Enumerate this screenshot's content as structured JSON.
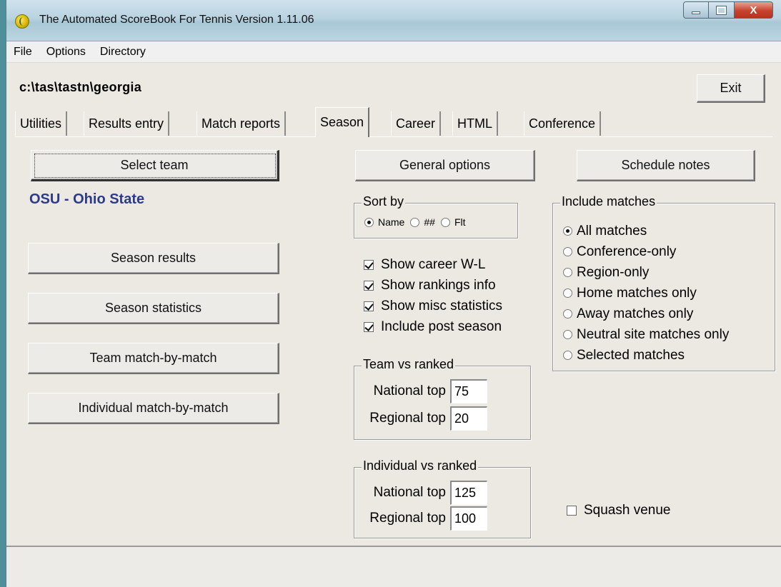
{
  "window": {
    "title": "The Automated ScoreBook For Tennis  Version 1.11.06",
    "controls": {
      "minimize_icon": "minimize-icon",
      "maximize_icon": "maximize-icon",
      "close_glyph": "X"
    }
  },
  "menu": [
    "File",
    "Options",
    "Directory"
  ],
  "path": "c:\\tas\\tastn\\georgia",
  "exit_label": "Exit",
  "tabs": [
    {
      "label": "Utilities",
      "active": false
    },
    {
      "label": "Results entry",
      "active": false
    },
    {
      "label": "Match reports",
      "active": false
    },
    {
      "label": "Season",
      "active": true
    },
    {
      "label": "Career",
      "active": false
    },
    {
      "label": "HTML",
      "active": false
    },
    {
      "label": "Conference",
      "active": false
    }
  ],
  "left": {
    "select_team": "Select team",
    "team_name": "OSU - Ohio State",
    "season_results": "Season results",
    "season_statistics": "Season statistics",
    "team_mbm": "Team match-by-match",
    "individual_mbm": "Individual match-by-match"
  },
  "general_options": "General options",
  "schedule_notes": "Schedule notes",
  "sort_by": {
    "legend": "Sort by",
    "options": [
      {
        "label": "Name",
        "selected": true
      },
      {
        "label": "##",
        "selected": false
      },
      {
        "label": "Flt",
        "selected": false
      }
    ]
  },
  "checks": [
    {
      "label": "Show career W-L",
      "checked": true
    },
    {
      "label": "Show rankings info",
      "checked": true
    },
    {
      "label": "Show misc statistics",
      "checked": true
    },
    {
      "label": "Include post season",
      "checked": true
    }
  ],
  "team_vs_ranked": {
    "legend": "Team vs ranked",
    "national_label": "National top",
    "national_value": "75",
    "regional_label": "Regional top",
    "regional_value": "20"
  },
  "individual_vs_ranked": {
    "legend": "Individual vs ranked",
    "national_label": "National top",
    "national_value": "125",
    "regional_label": "Regional top",
    "regional_value": "100"
  },
  "include_matches": {
    "legend": "Include matches",
    "options": [
      {
        "label": "All matches",
        "selected": true
      },
      {
        "label": "Conference-only",
        "selected": false
      },
      {
        "label": "Region-only",
        "selected": false
      },
      {
        "label": "Home matches only",
        "selected": false
      },
      {
        "label": "Away matches only",
        "selected": false
      },
      {
        "label": "Neutral site matches only",
        "selected": false
      },
      {
        "label": "Selected matches",
        "selected": false
      }
    ]
  },
  "squash_venue": {
    "label": "Squash venue",
    "checked": false
  }
}
